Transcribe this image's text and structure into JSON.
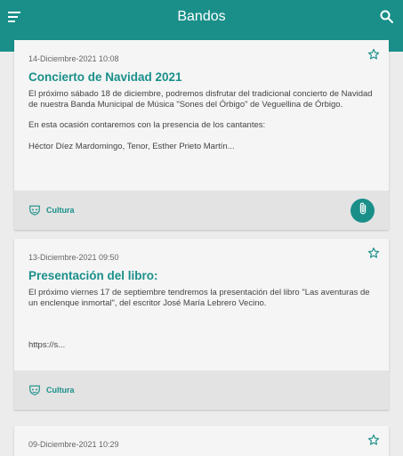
{
  "app": {
    "title": "Bandos"
  },
  "icons": {
    "menu": "menu-icon",
    "search": "search-icon",
    "star": "star-outline-icon",
    "category": "shield-logo-icon",
    "attachment": "paperclip-icon"
  },
  "colors": {
    "primary": "#1a8f8a",
    "card": "#f5f5f5",
    "footer": "#e3e3e3",
    "background": "#ececec"
  },
  "posts": [
    {
      "date": "14-Diciembre-2021 10:08",
      "title": "Concierto de Navidad 2021",
      "p1": "El próximo sábado 18 de diciembre, podremos disfrutar del tradicional concierto de Navidad de nuestra Banda Municipal de Música \"Sones del Órbigo\" de Veguellina de Órbigo.",
      "p2": "En esta ocasión contaremos con la presencia de los cantantes:",
      "p3": "Héctor Díez Mardomingo, Tenor, Esther Prieto Martín...",
      "category": "Cultura"
    },
    {
      "date": "13-Diciembre-2021 09:50",
      "title": "Presentación del libro:",
      "p1": "El próximo viernes 17 de septiembre tendremos la presentación del libro \"Las aventuras de un enclenque inmortal\", del escritor José María Lebrero Vecino.",
      "p2": "https://s...",
      "category": "Cultura"
    },
    {
      "date": "09-Diciembre-2021 10:29"
    }
  ]
}
